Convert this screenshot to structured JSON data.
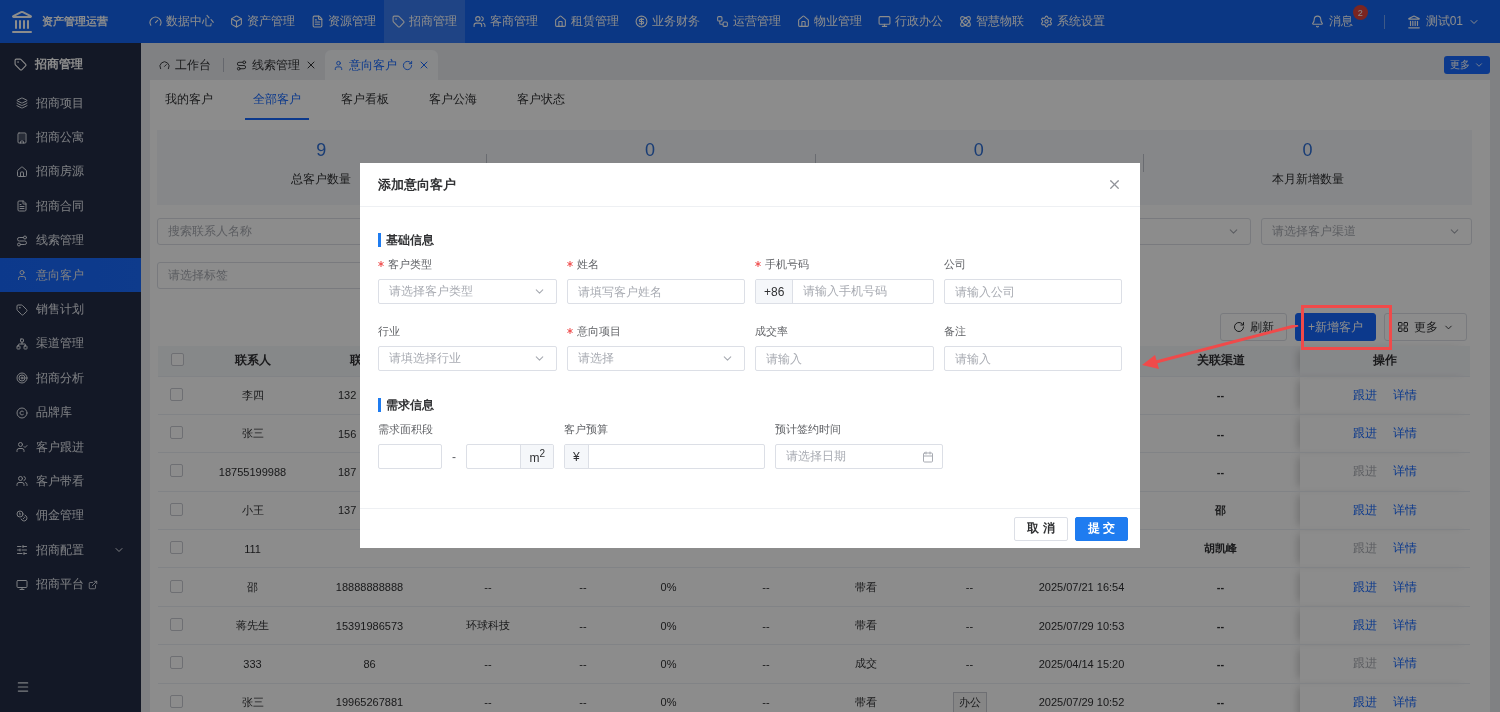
{
  "app": {
    "title": "资产管理运营"
  },
  "top_nav": [
    {
      "label": "数据中心",
      "selected": false
    },
    {
      "label": "资产管理",
      "selected": false
    },
    {
      "label": "资源管理",
      "selected": false
    },
    {
      "label": "招商管理",
      "selected": true
    },
    {
      "label": "客商管理",
      "selected": false
    },
    {
      "label": "租赁管理",
      "selected": false
    },
    {
      "label": "业务财务",
      "selected": false
    },
    {
      "label": "运营管理",
      "selected": false
    },
    {
      "label": "物业管理",
      "selected": false
    },
    {
      "label": "行政办公",
      "selected": false
    },
    {
      "label": "智慧物联",
      "selected": false
    },
    {
      "label": "系统设置",
      "selected": false
    }
  ],
  "user_area": {
    "messages": "消息",
    "badge": "2",
    "user": "测试01"
  },
  "sidebar": {
    "title": "招商管理",
    "items": [
      {
        "label": "招商项目",
        "kind": "page",
        "selected": false
      },
      {
        "label": "招商公寓",
        "kind": "page",
        "selected": false
      },
      {
        "label": "招商房源",
        "kind": "page",
        "selected": false
      },
      {
        "label": "招商合同",
        "kind": "page",
        "selected": false
      },
      {
        "label": "线索管理",
        "kind": "page",
        "selected": false
      },
      {
        "label": "意向客户",
        "kind": "page",
        "selected": true
      },
      {
        "label": "销售计划",
        "kind": "page",
        "selected": false
      },
      {
        "label": "渠道管理",
        "kind": "page",
        "selected": false
      },
      {
        "label": "招商分析",
        "kind": "page",
        "selected": false
      },
      {
        "label": "品牌库",
        "kind": "page",
        "selected": false
      },
      {
        "label": "客户跟进",
        "kind": "page",
        "selected": false
      },
      {
        "label": "客户带看",
        "kind": "page",
        "selected": false
      },
      {
        "label": "佣金管理",
        "kind": "page",
        "selected": false
      },
      {
        "label": "招商配置",
        "kind": "group",
        "selected": false
      },
      {
        "label": "招商平台",
        "kind": "external",
        "selected": false
      }
    ]
  },
  "page_tabs": {
    "items": [
      {
        "label": "工作台",
        "closable": false,
        "selected": false
      },
      {
        "label": "线索管理",
        "closable": true,
        "selected": false
      },
      {
        "label": "意向客户",
        "closable": true,
        "selected": true
      }
    ],
    "more": "更多"
  },
  "sub_tabs": [
    {
      "label": "我的客户",
      "selected": false
    },
    {
      "label": "全部客户",
      "selected": true
    },
    {
      "label": "客户看板",
      "selected": false
    },
    {
      "label": "客户公海",
      "selected": false
    },
    {
      "label": "客户状态",
      "selected": false
    }
  ],
  "stats": [
    {
      "value": "9",
      "label": "总客户数量"
    },
    {
      "value": "0"
    },
    {
      "value": "0"
    },
    {
      "value": "0",
      "label": "本月新增数量"
    }
  ],
  "filters": [
    [
      {
        "kind": "input",
        "placeholder": "搜索联系人名称"
      },
      {
        "kind": "select"
      },
      {
        "kind": "select",
        "placeholder": "请选择客户渠道"
      }
    ],
    [
      {
        "kind": "input",
        "placeholder": "请选择标签"
      }
    ]
  ],
  "toolbar": {
    "refresh": "刷新",
    "add": "+新增客户",
    "more": "更多"
  },
  "table": {
    "select_all": {
      "checked": false
    },
    "header": {
      "contact": "联系人",
      "phone": "联",
      "channel": "关联渠道",
      "actions": "操作"
    },
    "rows": [
      {
        "checked": false,
        "contact": "李四",
        "phone": "132",
        "channel": "--",
        "follow": {
          "label": "跟进",
          "disabled": false
        },
        "detail": "详情"
      },
      {
        "checked": false,
        "contact": "张三",
        "phone": "156",
        "channel": "--",
        "follow": {
          "label": "跟进",
          "disabled": false
        },
        "detail": "详情"
      },
      {
        "checked": false,
        "contact": "18755199988",
        "phone": "187",
        "channel": "--",
        "follow": {
          "label": "跟进",
          "disabled": true
        },
        "detail": "详情"
      },
      {
        "checked": false,
        "contact": "小王",
        "phone": "137",
        "channel": "邵",
        "follow": {
          "label": "跟进",
          "disabled": false
        },
        "detail": "详情"
      },
      {
        "checked": false,
        "contact": "111",
        "channel": "胡凯峰",
        "follow": {
          "label": "跟进",
          "disabled": true
        },
        "detail": "详情"
      },
      {
        "checked": false,
        "contact": "邵",
        "phone": "18888888888",
        "cells": [
          {
            "kind": "text",
            "text": "--"
          },
          {
            "kind": "text",
            "text": "--"
          },
          {
            "kind": "text",
            "text": "0%"
          },
          {
            "kind": "text",
            "text": "--"
          },
          {
            "kind": "text",
            "text": "带看"
          },
          {
            "kind": "text",
            "text": "--"
          },
          {
            "kind": "text",
            "text": "2025/07/21 16:54"
          }
        ],
        "channel": "--",
        "follow": {
          "label": "跟进",
          "disabled": false
        },
        "detail": "详情"
      },
      {
        "checked": false,
        "contact": "蒋先生",
        "phone": "15391986573",
        "cells": [
          {
            "kind": "text",
            "text": "环球科技"
          },
          {
            "kind": "text",
            "text": "--"
          },
          {
            "kind": "text",
            "text": "0%"
          },
          {
            "kind": "text",
            "text": "--"
          },
          {
            "kind": "text",
            "text": "带看"
          },
          {
            "kind": "text",
            "text": "--"
          },
          {
            "kind": "text",
            "text": "2025/07/29 10:53"
          }
        ],
        "channel": "--",
        "follow": {
          "label": "跟进",
          "disabled": false
        },
        "detail": "详情"
      },
      {
        "checked": false,
        "contact": "333",
        "phone": "86",
        "cells": [
          {
            "kind": "text",
            "text": "--"
          },
          {
            "kind": "text",
            "text": "--"
          },
          {
            "kind": "text",
            "text": "0%"
          },
          {
            "kind": "text",
            "text": "--"
          },
          {
            "kind": "text",
            "text": "成交"
          },
          {
            "kind": "text",
            "text": "--"
          },
          {
            "kind": "text",
            "text": "2025/04/14 15:20"
          }
        ],
        "channel": "--",
        "follow": {
          "label": "跟进",
          "disabled": true
        },
        "detail": "详情"
      },
      {
        "checked": false,
        "contact": "张三",
        "phone": "19965267881",
        "cells": [
          {
            "kind": "text",
            "text": "--"
          },
          {
            "kind": "text",
            "text": "--"
          },
          {
            "kind": "text",
            "text": "0%"
          },
          {
            "kind": "text",
            "text": "--"
          },
          {
            "kind": "text",
            "text": "带看"
          },
          {
            "kind": "tag",
            "text": "办公"
          },
          {
            "kind": "text",
            "text": "2025/07/29 10:52"
          }
        ],
        "channel": "--",
        "follow": {
          "label": "跟进",
          "disabled": false
        },
        "detail": "详情"
      }
    ]
  },
  "dialog": {
    "title": "添加意向客户",
    "sections": [
      {
        "title": "基础信息",
        "fields": [
          {
            "label": "客户类型",
            "required": true,
            "kind": "select",
            "placeholder": "请选择客户类型"
          },
          {
            "label": "姓名",
            "required": true,
            "kind": "input",
            "placeholder": "请填写客户姓名"
          },
          {
            "label": "手机号码",
            "required": true,
            "kind": "prefixed",
            "prefix": "+86",
            "placeholder": "请输入手机号码"
          },
          {
            "label": "公司",
            "required": false,
            "kind": "input",
            "placeholder": "请输入公司"
          },
          {
            "label": "行业",
            "required": false,
            "kind": "select",
            "placeholder": "请填选择行业"
          },
          {
            "label": "意向项目",
            "required": true,
            "kind": "select",
            "placeholder": "请选择"
          },
          {
            "label": "成交率",
            "required": false,
            "kind": "input",
            "placeholder": "请输入"
          },
          {
            "label": "备注",
            "required": false,
            "kind": "input",
            "placeholder": "请输入"
          }
        ]
      },
      {
        "title": "需求信息",
        "fields": [
          {
            "label": "需求面积段",
            "required": false,
            "kind": "range",
            "separator": "-",
            "suffix": "m$^{2}$"
          },
          {
            "label": "客户预算",
            "required": false,
            "kind": "prefixed",
            "prefix": "¥"
          },
          {
            "label": "预计签约时间",
            "required": false,
            "kind": "date",
            "placeholder": "请选择日期"
          }
        ]
      }
    ],
    "buttons": [
      {
        "label": "取 消",
        "kind": "default"
      },
      {
        "label": "提 交",
        "kind": "primary"
      }
    ]
  }
}
